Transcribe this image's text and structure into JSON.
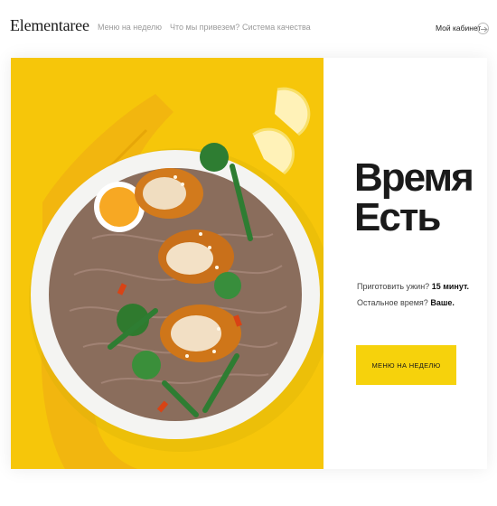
{
  "header": {
    "logo": "Elementaree",
    "nav": [
      {
        "label": "Меню на неделю"
      },
      {
        "label": "Что мы привезем?"
      },
      {
        "label": "Система качества"
      }
    ],
    "account_label": "Мой кабинет"
  },
  "hero": {
    "headline_line1": "Время",
    "headline_line2": "Есть",
    "desc_line1_label": "Приготовить ужин?",
    "desc_line1_value": "15 минут.",
    "desc_line2_label": "Остальное время?",
    "desc_line2_value": "Ваше.",
    "cta_label": "МЕНЮ НА НЕДЕЛЮ"
  },
  "colors": {
    "accent": "#f6d20c",
    "image_background": "#f6c60a"
  }
}
